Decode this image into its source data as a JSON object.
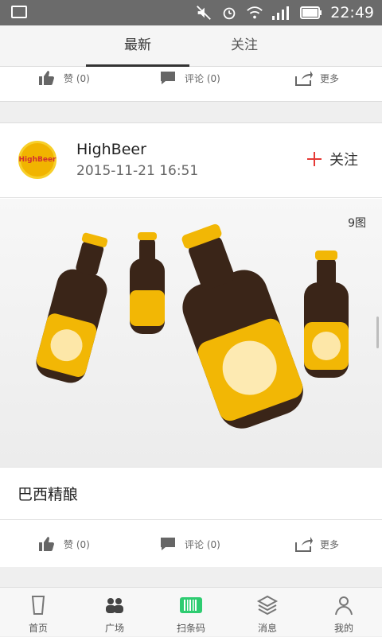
{
  "status_bar": {
    "time": "22:49"
  },
  "tabs": {
    "latest": "最新",
    "follow": "关注"
  },
  "actions": {
    "like": "赞 (0)",
    "comment": "评论 (0)",
    "more": "更多"
  },
  "post": {
    "username": "HighBeer",
    "datetime": "2015-11-21 16:51",
    "follow_label": "关注",
    "image_badge": "9图",
    "caption": "巴西精酿",
    "avatar_text": "HighBeer"
  },
  "bottom_nav": [
    {
      "label": "首页",
      "icon": "beer-glass-icon"
    },
    {
      "label": "广场",
      "icon": "people-icon"
    },
    {
      "label": "扫条码",
      "icon": "barcode-icon"
    },
    {
      "label": "消息",
      "icon": "layers-icon"
    },
    {
      "label": "我的",
      "icon": "person-icon"
    }
  ],
  "colors": {
    "accent_red": "#e53935",
    "barcode_green": "#2ecc71",
    "beer_yellow": "#f2b705"
  }
}
